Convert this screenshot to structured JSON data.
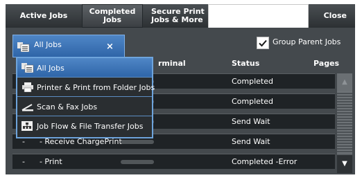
{
  "tabs": {
    "active_jobs": "Active Jobs",
    "completed_jobs_line1": "Completed",
    "completed_jobs_line2": "Jobs",
    "secure_print_line1": "Secure Print",
    "secure_print_line2": "Jobs & More",
    "close": "Close"
  },
  "filter": {
    "selected": "All Jobs",
    "clear_label": "×"
  },
  "group_parent": {
    "label": "Group Parent Jobs",
    "checked": true
  },
  "table": {
    "headers": {
      "terminal": "rminal",
      "status": "Status",
      "pages": "Pages"
    },
    "rows": [
      {
        "type": "",
        "status": "Completed"
      },
      {
        "type": "",
        "status": "Completed"
      },
      {
        "type": "",
        "status": "Send Wait"
      },
      {
        "type": "-      - Receive ChargePrint",
        "status": "Send Wait"
      },
      {
        "type": "-      - Print",
        "status": "Completed -Error"
      }
    ]
  },
  "dropdown_options": [
    {
      "label": "All Jobs",
      "icon": "all-jobs-icon",
      "selected": true
    },
    {
      "label": "Printer & Print from Folder Jobs",
      "icon": "printer-icon",
      "selected": false
    },
    {
      "label": "Scan & Fax Jobs",
      "icon": "scanner-icon",
      "selected": false
    },
    {
      "label": "Job Flow & File Transfer Jobs",
      "icon": "job-flow-icon",
      "selected": false
    }
  ],
  "colors": {
    "panel": "#44494d",
    "row": "#1f2326",
    "accent": "#3a74b8",
    "accent_border": "#6ea4dc"
  }
}
